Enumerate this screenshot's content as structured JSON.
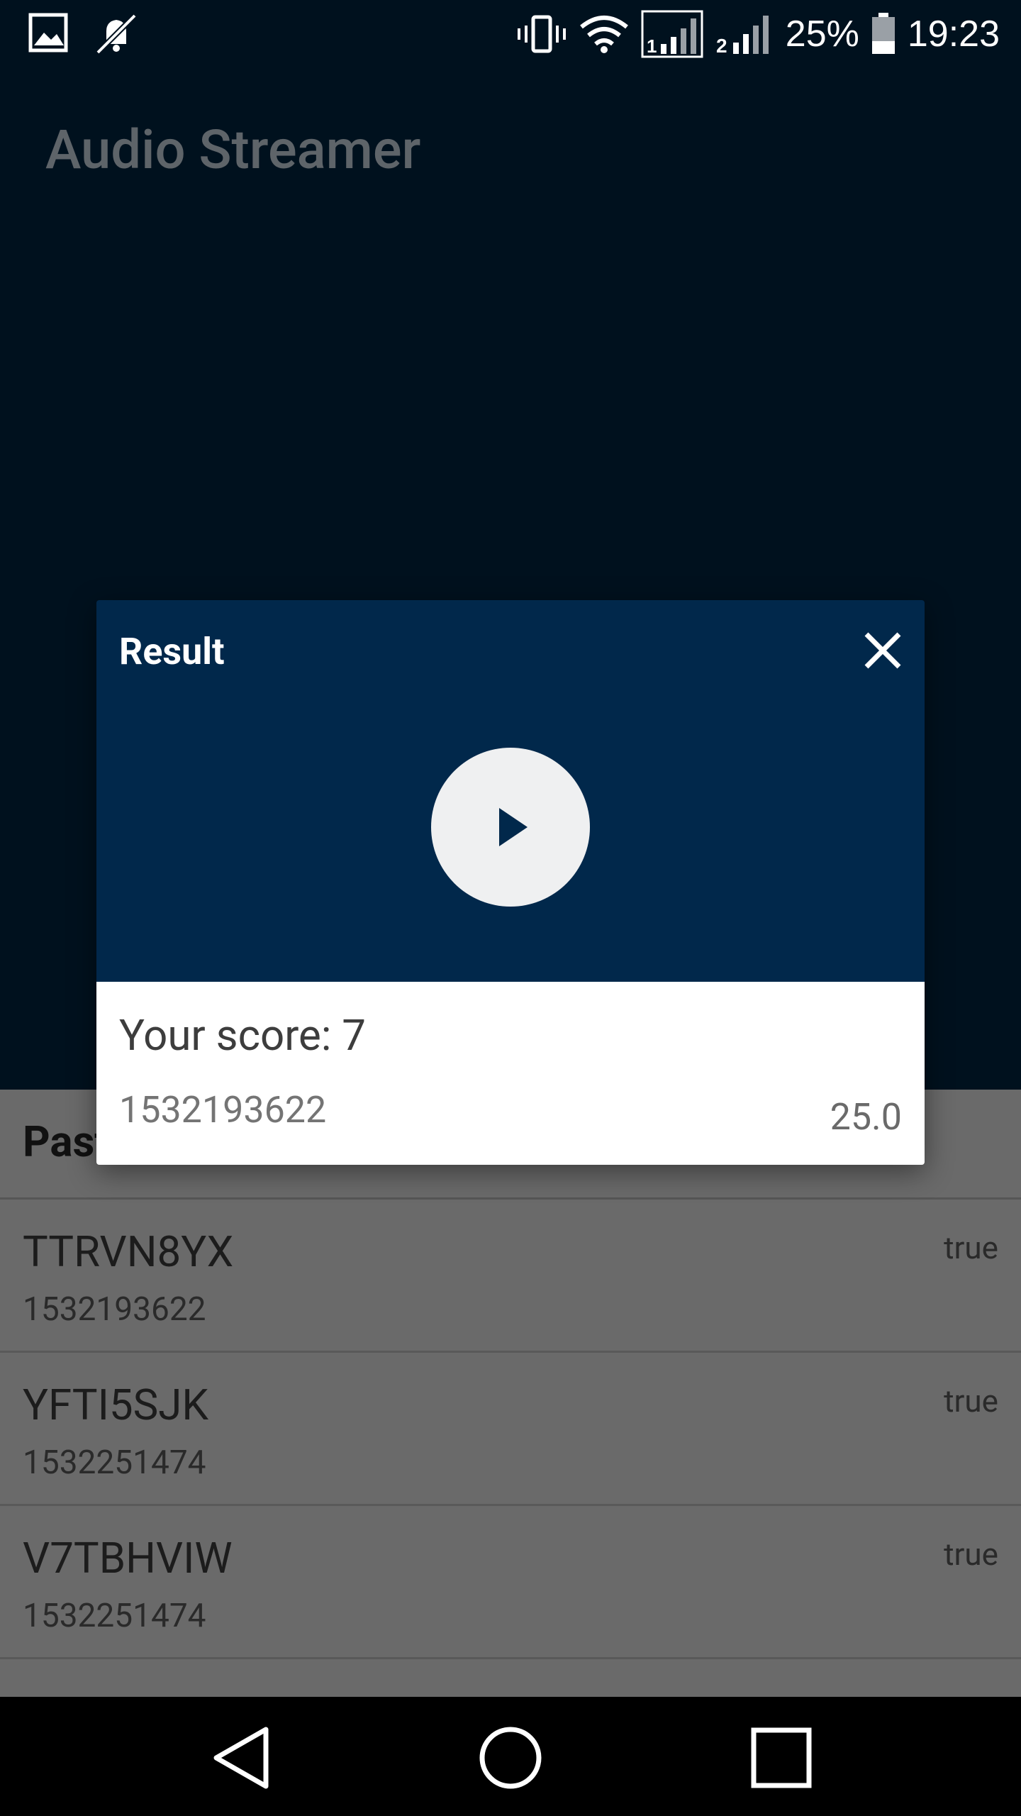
{
  "status_bar": {
    "battery_percent": "25%",
    "time": "19:23",
    "left_icons": [
      "image-icon",
      "notifications-off-icon"
    ],
    "right_icons": [
      "vibrate-icon",
      "wifi-icon",
      "sim1-signal-icon",
      "sim2-signal-icon",
      "battery-icon"
    ]
  },
  "app": {
    "title": "Audio Streamer"
  },
  "list": {
    "header": "Past",
    "rows": [
      {
        "id": "TTRVN8YX",
        "timestamp": "1532193622",
        "flag": "true"
      },
      {
        "id": "YFTI5SJK",
        "timestamp": "1532251474",
        "flag": "true"
      },
      {
        "id": "V7TBHVIW",
        "timestamp": "1532251474",
        "flag": "true"
      }
    ]
  },
  "dialog": {
    "title": "Result",
    "score_label": "Your score: 7",
    "timestamp": "1532193622",
    "value": "25.0",
    "icons": [
      "close-icon",
      "play-icon"
    ]
  },
  "nav_bar": {
    "buttons": [
      "back-icon",
      "home-icon",
      "recents-icon"
    ]
  },
  "colors": {
    "app_bg": "#00111e",
    "dialog_header": "#01284b",
    "list_bg": "#6a6a6a"
  }
}
